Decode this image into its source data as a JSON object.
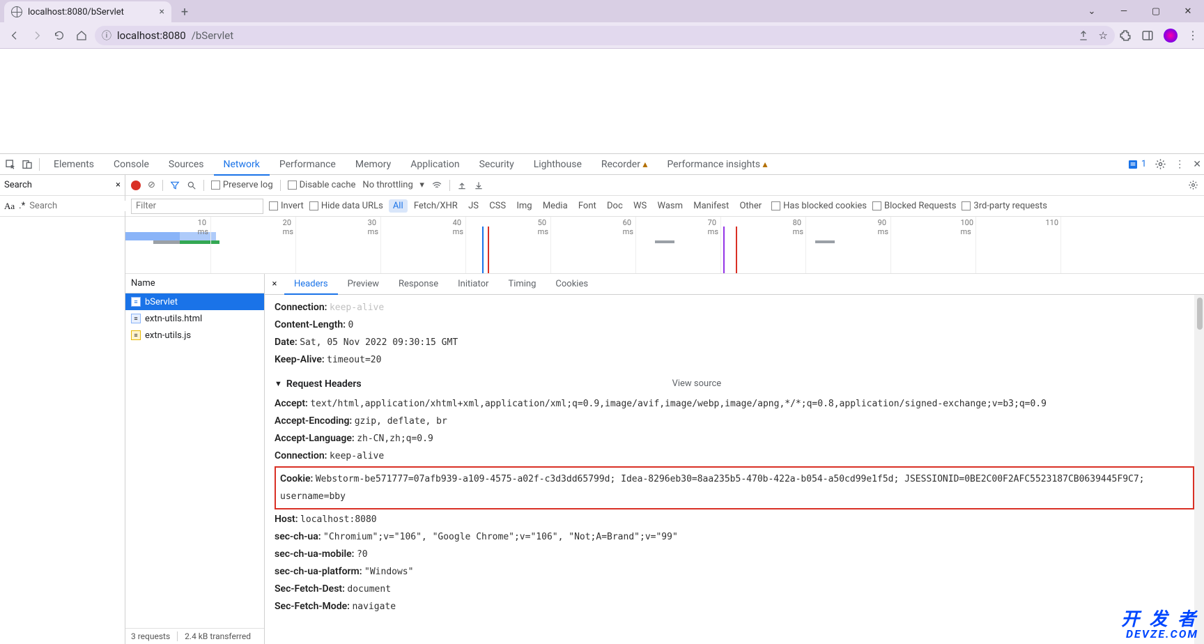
{
  "browser": {
    "tab_title": "localhost:8080/bServlet",
    "url_host": "localhost:8080",
    "url_path": "/bServlet",
    "window_buttons": {
      "dropdown": "⌄",
      "min": "—",
      "max": "▢",
      "close": "✕"
    }
  },
  "devtools": {
    "tabs": [
      "Elements",
      "Console",
      "Sources",
      "Network",
      "Performance",
      "Memory",
      "Application",
      "Security",
      "Lighthouse",
      "Recorder",
      "Performance insights"
    ],
    "active_tab": "Network",
    "issues_count": "1"
  },
  "search_panel": {
    "title": "Search",
    "aa": "Aa",
    "regex": ".*",
    "placeholder": "Search"
  },
  "net_toolbar": {
    "preserve": "Preserve log",
    "disable": "Disable cache",
    "throttle": "No throttling"
  },
  "net_filter": {
    "placeholder": "Filter",
    "invert": "Invert",
    "hide": "Hide data URLs",
    "types": [
      "All",
      "Fetch/XHR",
      "JS",
      "CSS",
      "Img",
      "Media",
      "Font",
      "Doc",
      "WS",
      "Wasm",
      "Manifest",
      "Other"
    ],
    "active_type": "All",
    "blocked_cookies": "Has blocked cookies",
    "blocked_req": "Blocked Requests",
    "third": "3rd-party requests"
  },
  "timeline_ticks": [
    "10 ms",
    "20 ms",
    "30 ms",
    "40 ms",
    "50 ms",
    "60 ms",
    "70 ms",
    "80 ms",
    "90 ms",
    "100 ms",
    "110"
  ],
  "requests": {
    "header": "Name",
    "items": [
      {
        "name": "bServlet",
        "kind": "doc",
        "selected": true
      },
      {
        "name": "extn-utils.html",
        "kind": "doc"
      },
      {
        "name": "extn-utils.js",
        "kind": "js"
      }
    ],
    "status": {
      "count": "3 requests",
      "transfer": "2.4 kB transferred"
    }
  },
  "detail": {
    "tabs": [
      "Headers",
      "Preview",
      "Response",
      "Initiator",
      "Timing",
      "Cookies"
    ],
    "active": "Headers",
    "top": [
      {
        "k": "Content-Length:",
        "v": "0"
      },
      {
        "k": "Date:",
        "v": "Sat, 05 Nov 2022 09:30:15 GMT"
      },
      {
        "k": "Keep-Alive:",
        "v": "timeout=20"
      }
    ],
    "section": "Request Headers",
    "view_source": "View source",
    "rows": [
      {
        "k": "Accept:",
        "v": "text/html,application/xhtml+xml,application/xml;q=0.9,image/avif,image/webp,image/apng,*/*;q=0.8,application/signed-exchange;v=b3;q=0.9"
      },
      {
        "k": "Accept-Encoding:",
        "v": "gzip, deflate, br"
      },
      {
        "k": "Accept-Language:",
        "v": "zh-CN,zh;q=0.9"
      },
      {
        "k": "Connection:",
        "v": "keep-alive"
      },
      {
        "k": "Cookie:",
        "v": "Webstorm-be571777=07afb939-a109-4575-a02f-c3d3dd65799d; Idea-8296eb30=8aa235b5-470b-422a-b054-a50cd99e1f5d; JSESSIONID=0BE2C00F2AFC5523187CB0639445F9C7; username=bby",
        "highlight": true
      },
      {
        "k": "Host:",
        "v": "localhost:8080"
      },
      {
        "k": "sec-ch-ua:",
        "v": "\"Chromium\";v=\"106\", \"Google Chrome\";v=\"106\", \"Not;A=Brand\";v=\"99\""
      },
      {
        "k": "sec-ch-ua-mobile:",
        "v": "?0"
      },
      {
        "k": "sec-ch-ua-platform:",
        "v": "\"Windows\""
      },
      {
        "k": "Sec-Fetch-Dest:",
        "v": "document"
      },
      {
        "k": "Sec-Fetch-Mode:",
        "v": "navigate"
      }
    ]
  },
  "watermark": {
    "line1": "开 发 者",
    "line2": "DEVZE.COM"
  }
}
